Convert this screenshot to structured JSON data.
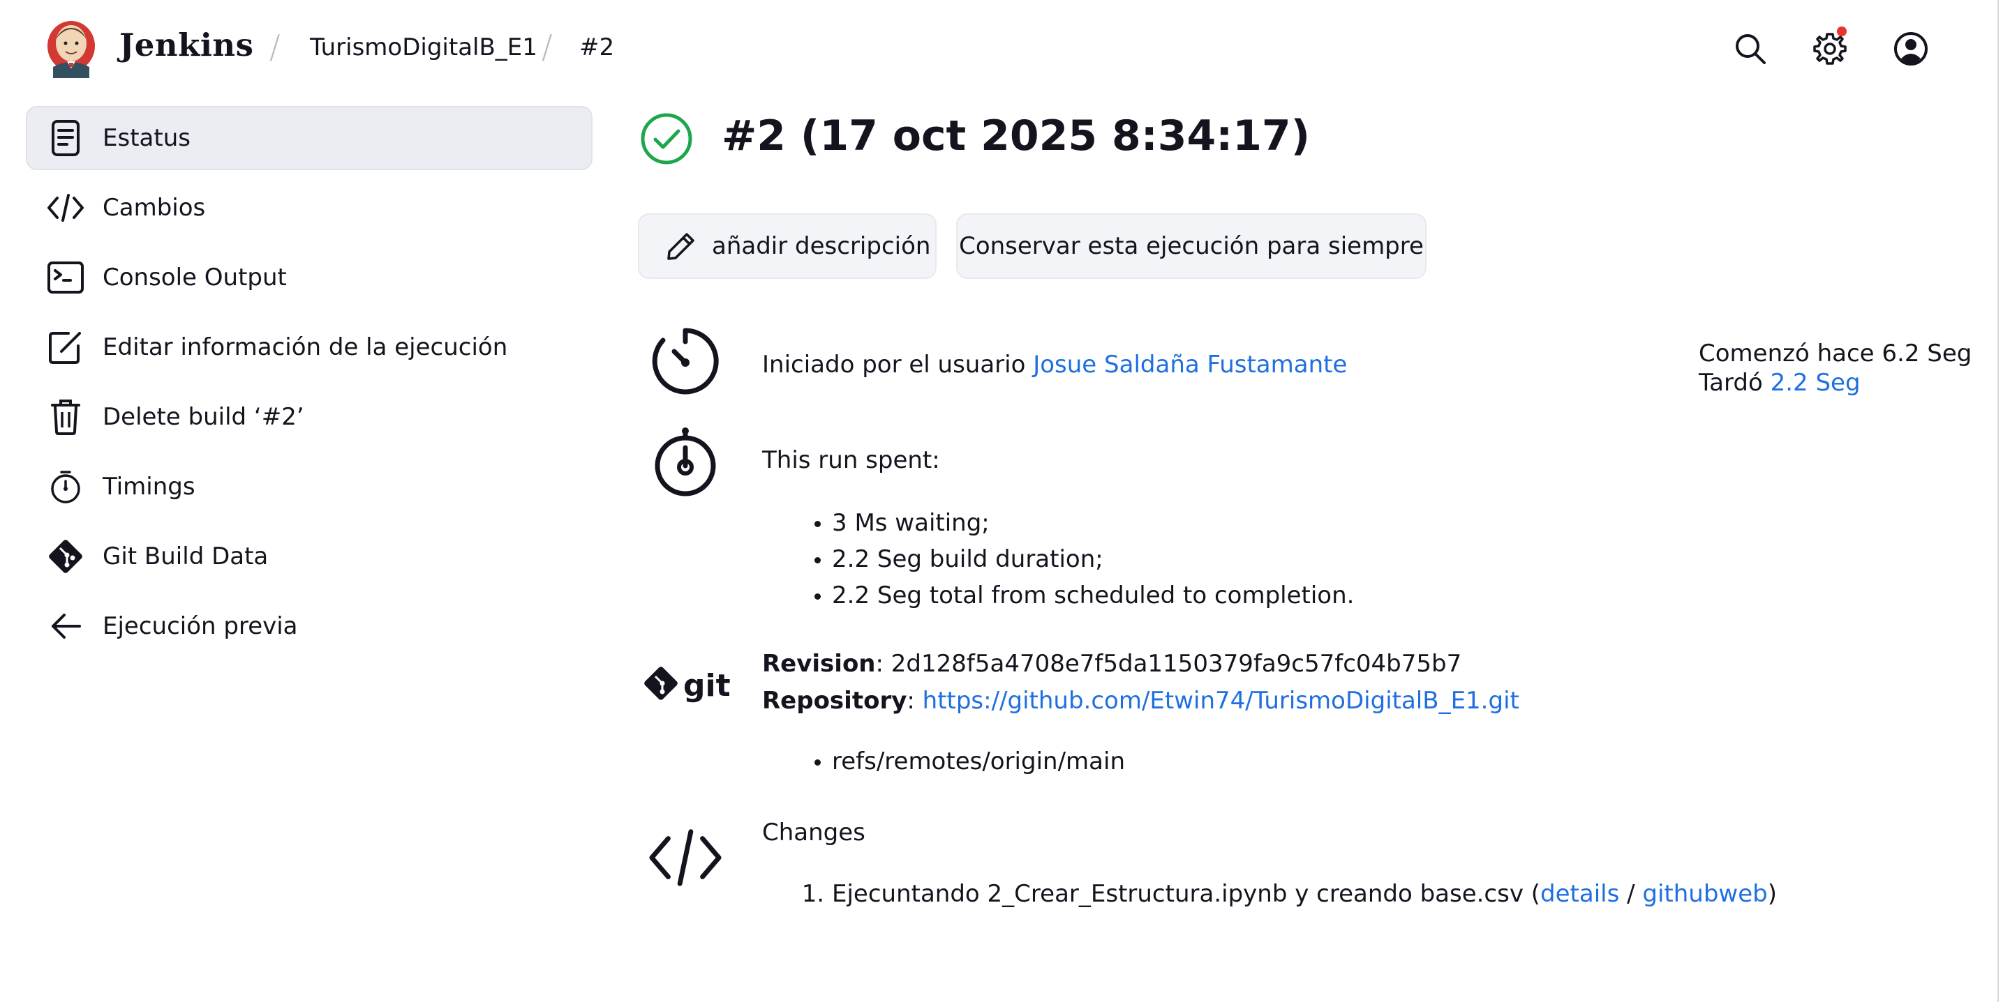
{
  "header": {
    "brand": "Jenkins",
    "breadcrumbs": [
      "TurismoDigitalB_E1",
      "#2"
    ],
    "icons": [
      "search-icon",
      "gear-icon",
      "user-account-icon"
    ],
    "notification_color": "#e6352b"
  },
  "sidebar": {
    "items": [
      {
        "label": "Estatus",
        "icon": "document-icon",
        "active": true
      },
      {
        "label": "Cambios",
        "icon": "code-icon"
      },
      {
        "label": "Console Output",
        "icon": "terminal-icon"
      },
      {
        "label": "Editar información de la ejecución",
        "icon": "edit-icon"
      },
      {
        "label": "Delete build ‘#2’",
        "icon": "trash-icon"
      },
      {
        "label": "Timings",
        "icon": "stopwatch-icon"
      },
      {
        "label": "Git Build Data",
        "icon": "git-icon"
      },
      {
        "label": "Ejecución previa",
        "icon": "arrow-left-icon"
      }
    ]
  },
  "main": {
    "title": "#2 (17 oct 2025 8:34:17)",
    "status": "success",
    "status_color": "#1ea64b",
    "buttons": {
      "add_description": "añadir descripción",
      "keep_forever": "Conservar esta ejecución para siempre"
    },
    "started_by": {
      "prefix": "Iniciado por el usuario ",
      "user": "Josue Saldaña Fustamante"
    },
    "timing": {
      "started_prefix": "Comenzó hace 6.2 Seg",
      "took_prefix": "Tardó ",
      "took_value": "2.2 Seg"
    },
    "run_spent": {
      "heading": "This run spent:",
      "items": [
        "3 Ms waiting;",
        "2.2 Seg build duration;",
        "2.2 Seg total from scheduled to completion."
      ]
    },
    "git": {
      "logo_text": "git",
      "revision_label": "Revision",
      "revision_value": ": 2d128f5a4708e7f5da1150379fa9c57fc04b75b7",
      "repository_label": "Repository",
      "repository_sep": ": ",
      "repository_url": "https://github.com/Etwin74/TurismoDigitalB_E1.git",
      "branches": [
        "refs/remotes/origin/main"
      ]
    },
    "changes": {
      "heading": "Changes",
      "items": [
        {
          "text": "Ejecuntando 2_Crear_Estructura.ipynb y creando base.csv (",
          "details": "details",
          "sep": " / ",
          "githubweb": "githubweb",
          "close": ")"
        }
      ]
    },
    "link_color": "#1f6fe0"
  }
}
